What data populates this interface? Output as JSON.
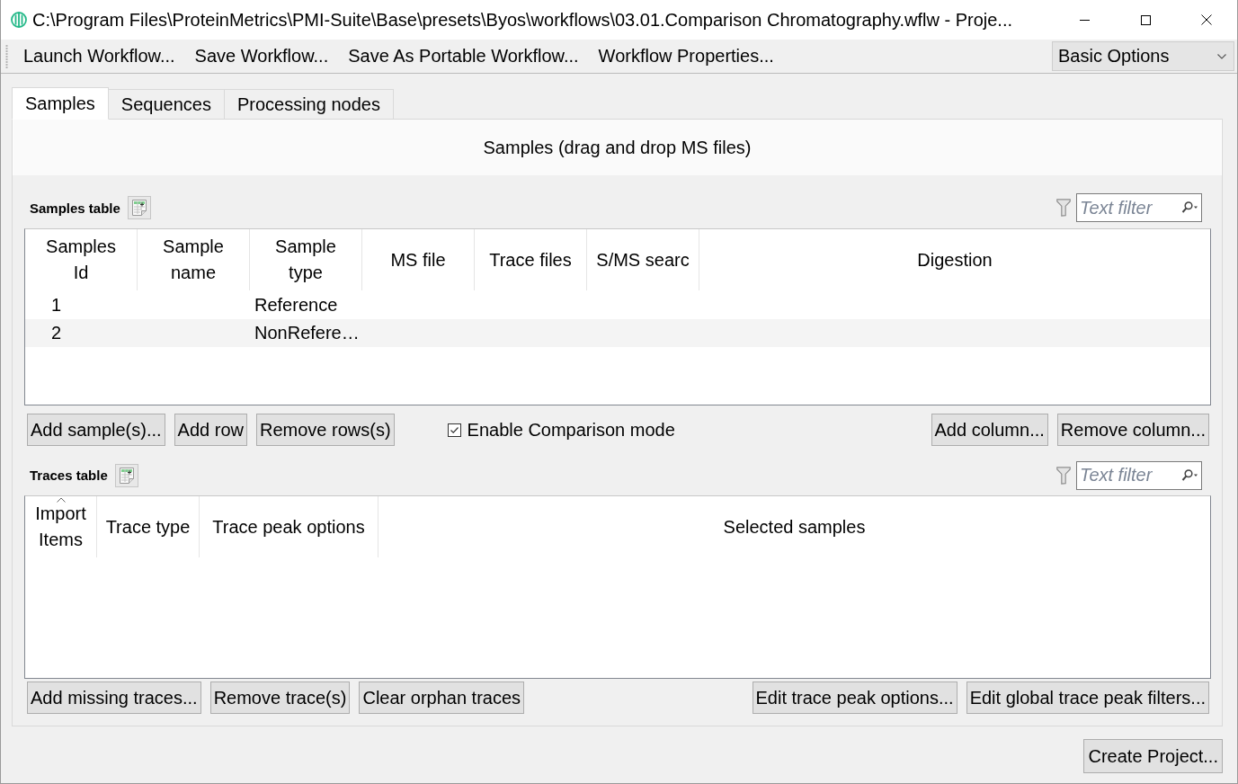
{
  "window": {
    "title": "C:\\Program Files\\ProteinMetrics\\PMI-Suite\\Base\\presets\\Byos\\workflows\\03.01.Comparison Chromatography.wflw - Proje..."
  },
  "toolbar": {
    "buttons": [
      "Launch Workflow...",
      "Save Workflow...",
      "Save As Portable Workflow...",
      "Workflow Properties..."
    ],
    "mode_dropdown": {
      "value": "Basic Options"
    }
  },
  "tabs": [
    {
      "label": "Samples",
      "selected": true
    },
    {
      "label": "Sequences",
      "selected": false
    },
    {
      "label": "Processing nodes",
      "selected": false
    }
  ],
  "samples_panel": {
    "heading": "Samples (drag and drop MS files)",
    "samples_table": {
      "title": "Samples table",
      "filter": {
        "placeholder": "Text filter"
      },
      "columns": [
        {
          "label": "Samples\nId"
        },
        {
          "label": "Sample\nname"
        },
        {
          "label": "Sample\ntype"
        },
        {
          "label": "MS file"
        },
        {
          "label": "Trace files"
        },
        {
          "label": "S/MS searc"
        },
        {
          "label": "Digestion"
        }
      ],
      "rows": [
        {
          "samples_id": "1",
          "sample_type": "Reference"
        },
        {
          "samples_id": "2",
          "sample_type": "NonRefere…"
        }
      ],
      "buttons_left": [
        "Add sample(s)...",
        "Add row",
        "Remove rows(s)"
      ],
      "comparison_mode": {
        "label": "Enable Comparison mode",
        "checked": true
      },
      "buttons_right": [
        "Add column...",
        "Remove column..."
      ]
    },
    "traces_table": {
      "title": "Traces table",
      "filter": {
        "placeholder": "Text filter"
      },
      "columns": [
        {
          "label": "Import\nItems",
          "sorted_ascending": true
        },
        {
          "label": "Trace type",
          "sorted_ascending": false
        },
        {
          "label": "Trace peak options",
          "sorted_ascending": false
        },
        {
          "label": "Selected samples",
          "sorted_ascending": false
        }
      ],
      "buttons_left": [
        "Add missing traces...",
        "Remove trace(s)",
        "Clear orphan traces"
      ],
      "buttons_right": [
        "Edit trace peak options...",
        "Edit global trace peak filters..."
      ]
    }
  },
  "create_button": "Create Project..."
}
